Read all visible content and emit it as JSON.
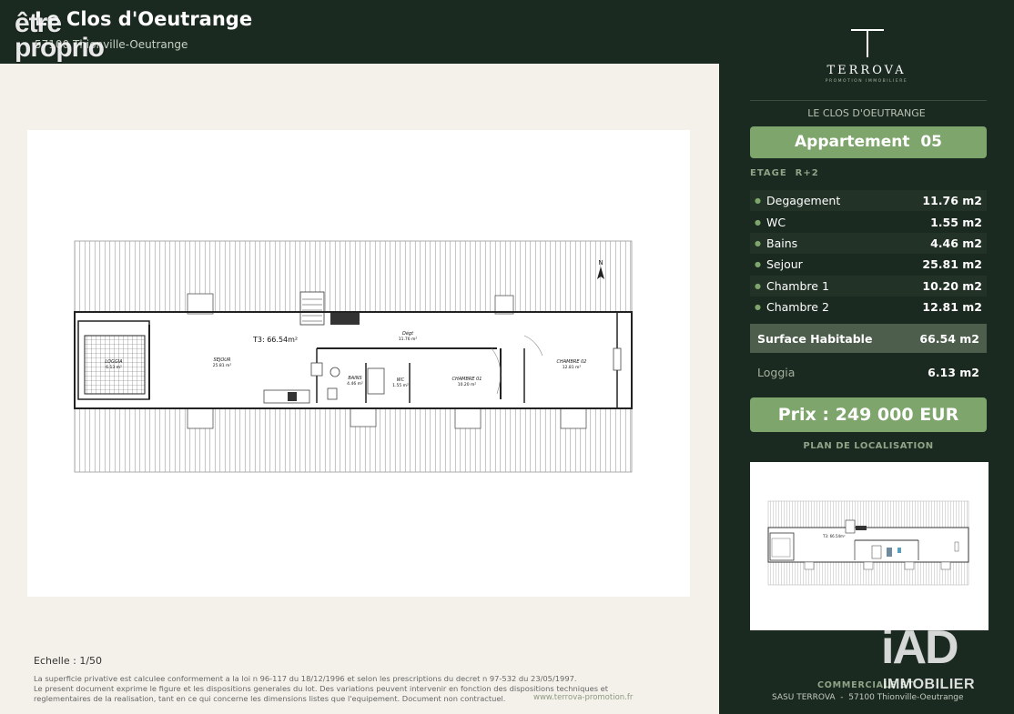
{
  "header": {
    "title": "Le Clos d'Oeutrange",
    "subtitle": "57100 Thionville-Oeutrange",
    "watermark": "être\nproprio"
  },
  "plan": {
    "area_label": "T3: 66.54m²",
    "rooms": [
      {
        "name": "LOGGIA",
        "area": "6.13 m²"
      },
      {
        "name": "SEJOUR",
        "area": "25.81 m²"
      },
      {
        "name": "Dégt",
        "area": "11.76 m²"
      },
      {
        "name": "BAINS",
        "area": "4.46 m²"
      },
      {
        "name": "WC",
        "area": "1.55 m²"
      },
      {
        "name": "CHAMBRE 01",
        "area": "10.20 m²"
      },
      {
        "name": "CHAMBRE 02",
        "area": "12.81 m²"
      }
    ],
    "compass": "N"
  },
  "footer": {
    "scale": "Echelle : 1/50",
    "legal_1": "La superficie privative est calculee conformement a la loi n 96-117 du 18/12/1996 et selon les prescriptions du decret n 97-532 du 23/05/1997.",
    "legal_2": "Le present document exprime le figure et les dispositions generales du lot. Des variations peuvent intervenir en fonction des dispositions techniques et",
    "legal_3": "reglementaires de la realisation, tant en ce qui concerne les dimensions listes que l'equipement. Document non contractuel.",
    "website": "www.terrova-promotion.fr"
  },
  "sidebar": {
    "brand": "TERROVA",
    "brand_sub": "PROMOTION IMMOBILIERE",
    "program": "LE CLOS D'OEUTRANGE",
    "apartment": "Appartement  05",
    "floor": "ETAGE  R+2",
    "rooms": [
      {
        "name": "Degagement",
        "value": "11.76 m2"
      },
      {
        "name": "WC",
        "value": "1.55 m2"
      },
      {
        "name": "Bains",
        "value": "4.46 m2"
      },
      {
        "name": "Sejour",
        "value": "25.81 m2"
      },
      {
        "name": "Chambre 1",
        "value": "10.20 m2"
      },
      {
        "name": "Chambre 2",
        "value": "12.81 m2"
      }
    ],
    "surface_label": "Surface Habitable",
    "surface_value": "66.54 m2",
    "loggia_label": "Loggia",
    "loggia_value": "6.13 m2",
    "price": "Prix : 249 000 EUR",
    "location_title": "PLAN DE LOCALISATION",
    "location_plan_label": "T3: 66.54m²",
    "commercial": "COMMERCIALE ST",
    "sasu": "SASU TERROVA  -  57100 Thionville-Oeutrange",
    "iad_logo": "iAD",
    "iad_sub": "IMMOBILIER"
  },
  "colors": {
    "dark_green": "#1b2a20",
    "accent_green": "#7ea66c",
    "surface_band": "#4d5e4c",
    "page_bg": "#f4f1ea"
  }
}
